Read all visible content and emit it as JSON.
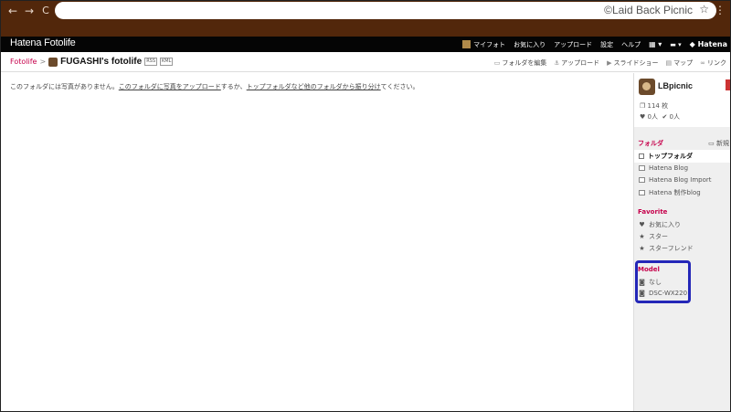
{
  "browser": {
    "url_text": "©Laid Back Picnic",
    "back": "←",
    "forward": "→",
    "reload": "C",
    "bookmark": "☆",
    "menu": "⋮"
  },
  "header": {
    "logo": "Hatena Fotolife",
    "menu": [
      "マイフォト",
      "お気に入り",
      "アップロード",
      "設定",
      "ヘルプ"
    ],
    "brand": "Hatena",
    "icons": [
      "grid-icon",
      "speech-bubble-icon"
    ]
  },
  "breadcrumb": {
    "root": "Fotolife",
    "separator": ">",
    "title": "FUGASHI's fotolife",
    "tags": [
      "RSS",
      "KML"
    ]
  },
  "tools": [
    "フォルダを編集",
    "アップロード",
    "スライドショー",
    "マップ",
    "リンク"
  ],
  "main": {
    "message_prefix": "このフォルダには写真がありません。",
    "link1": "このフォルダに写真をアップロード",
    "message_mid": "するか、",
    "link2": "トップフォルダなど他のフォルダから振り分け",
    "message_suffix": "てください。"
  },
  "profile": {
    "name": "LBpicnic",
    "photo_count": "114 枚",
    "hearts": "0人",
    "stars": "0人"
  },
  "sidebar": {
    "folder_heading": "フォルダ",
    "new_label": "新規",
    "folders": [
      "トップフォルダ",
      "Hatena Blog",
      "Hatena Blog Import",
      "Hatena 制作blog"
    ],
    "favorite_heading": "Favorite",
    "favorites": [
      "お気に入り",
      "スター",
      "スターフレンド"
    ],
    "model_heading": "Model",
    "models": [
      "なし",
      "DSC-WX220"
    ]
  },
  "colors": {
    "chrome": "#52270b",
    "accent": "#c6004b",
    "highlight": "#2427b8"
  }
}
